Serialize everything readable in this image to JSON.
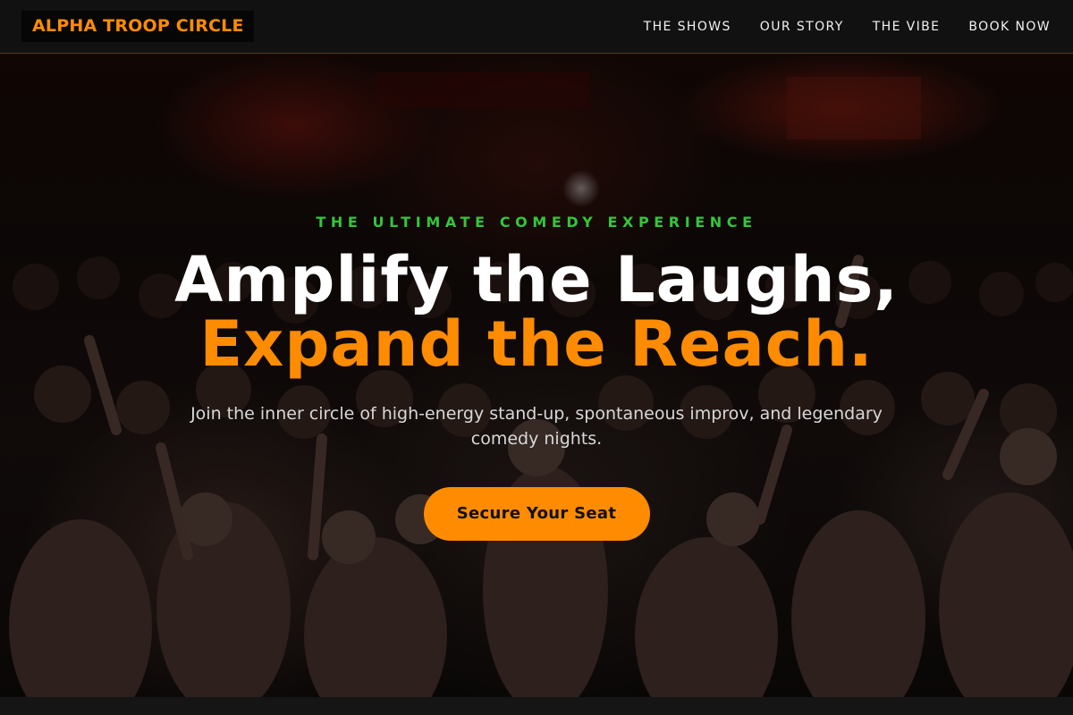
{
  "nav": {
    "logo": "ALPHA TROOP CIRCLE",
    "links": [
      "THE SHOWS",
      "OUR STORY",
      "THE VIBE",
      "BOOK NOW"
    ]
  },
  "hero": {
    "eyebrow": "THE ULTIMATE COMEDY EXPERIENCE",
    "headline_line1": "Amplify the Laughs,",
    "headline_line2": "Expand the Reach.",
    "subtext": "Join the inner circle of high-energy stand-up, spontaneous improv, and legendary comedy nights.",
    "cta_label": "Secure Your Seat"
  },
  "colors": {
    "accent": "#ff8c00",
    "eyebrow": "#33c63a",
    "nav_bg": "#111111",
    "text": "#ffffff"
  }
}
